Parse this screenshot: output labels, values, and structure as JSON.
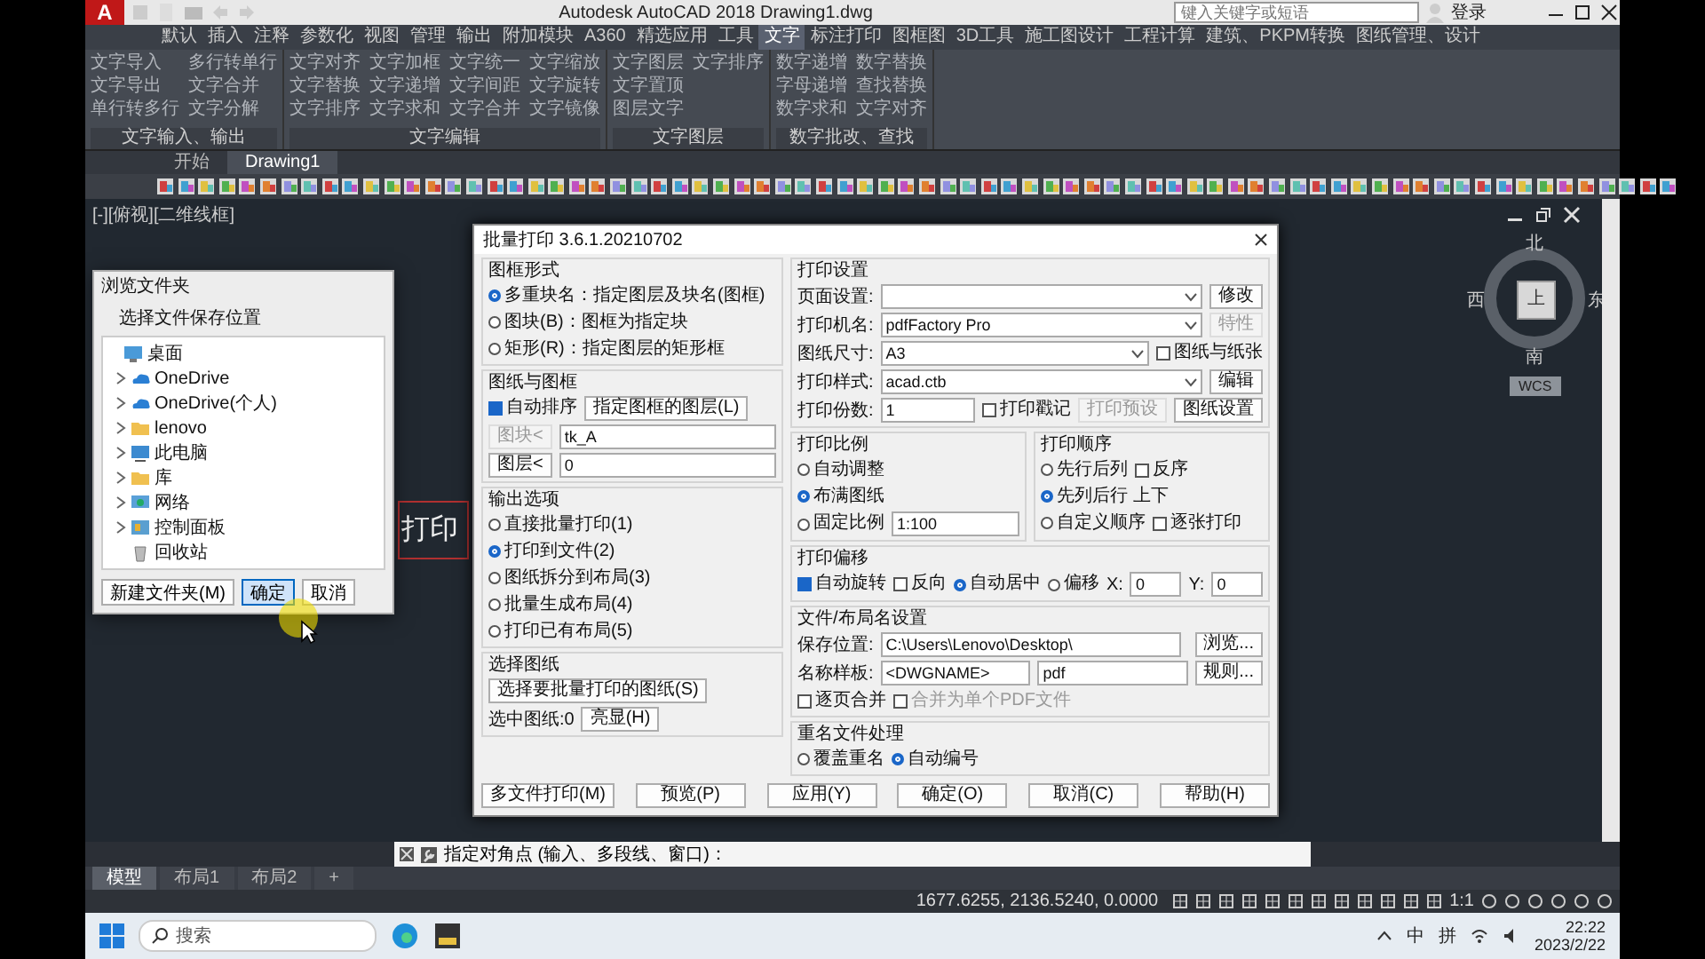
{
  "window": {
    "logo": "A",
    "title": "Autodesk AutoCAD 2018    Drawing1.dwg",
    "search_placeholder": "键入关键字或短语",
    "user": "登录"
  },
  "ribbon": {
    "tabs": [
      {
        "label": "默认",
        "selected": false
      },
      {
        "label": "插入",
        "selected": false
      },
      {
        "label": "注释",
        "selected": false
      },
      {
        "label": "参数化",
        "selected": false
      },
      {
        "label": "视图",
        "selected": false
      },
      {
        "label": "管理",
        "selected": false
      },
      {
        "label": "输出",
        "selected": false
      },
      {
        "label": "附加模块",
        "selected": false
      },
      {
        "label": "A360",
        "selected": false
      },
      {
        "label": "精选应用",
        "selected": false
      },
      {
        "label": "工具",
        "selected": false
      },
      {
        "label": "文字",
        "selected": true
      },
      {
        "label": "标注打印",
        "selected": false
      },
      {
        "label": "图框图",
        "selected": false
      },
      {
        "label": "3D工具",
        "selected": false
      },
      {
        "label": "施工图设计",
        "selected": false
      },
      {
        "label": "工程计算",
        "selected": false
      },
      {
        "label": "建筑、PKPM转换",
        "selected": false
      },
      {
        "label": "图纸管理、设计",
        "selected": false
      }
    ],
    "panels": [
      {
        "title": "文字输入、输出",
        "items": [
          "文字导入",
          "文字导出",
          "单行转多行",
          "多行转单行",
          "文字合并",
          "文字分解"
        ]
      },
      {
        "title": "文字编辑",
        "items": [
          "文字对齐",
          "文字替换",
          "文字排序",
          "文字加框",
          "文字递增",
          "文字求和",
          "文字统一",
          "文字间距",
          "文字合并",
          "文字缩放",
          "文字旋转",
          "文字镜像"
        ]
      },
      {
        "title": "文字图层",
        "items": [
          "文字图层",
          "文字置顶",
          "图层文字",
          "文字排序"
        ]
      },
      {
        "title": "数字批改、查找",
        "items": [
          "数字递增",
          "字母递增",
          "数字求和",
          "数字替换",
          "查找替换",
          "文字对齐"
        ]
      }
    ]
  },
  "file_tabs": [
    {
      "label": "开始",
      "selected": false
    },
    {
      "label": "Drawing1",
      "selected": true
    }
  ],
  "viewport_label": "[-][俯视][二维线框]",
  "drawing_text": "打印",
  "viewcube": {
    "north": "北",
    "west": "西",
    "east": "东",
    "south": "南",
    "face": "上",
    "ucs": "WCS"
  },
  "dialog": {
    "title": "批量打印 3.6.1.20210702",
    "left": [
      {
        "kind": "group",
        "title": "图框形式",
        "rows": [
          [
            {
              "kind": "radio",
              "label": "多重块名：指定图层及块名(图框)",
              "selected": true
            }
          ],
          [
            {
              "kind": "radio",
              "label": "图块(B)：图框为指定块",
              "selected": false
            }
          ],
          [
            {
              "kind": "radio",
              "label": "矩形(R)：指定图层的矩形框",
              "selected": false
            }
          ]
        ]
      },
      {
        "kind": "group",
        "title": "图纸与图框",
        "rows": [
          [
            {
              "kind": "checkbox",
              "label": "自动排序",
              "checked": true,
              "disabled": false
            },
            {
              "kind": "button",
              "label": "指定图框的图层(L)",
              "disabled": false
            }
          ],
          [
            {
              "kind": "button",
              "label": "图块<",
              "disabled": true
            },
            {
              "kind": "field",
              "value": "tk_A"
            }
          ],
          [
            {
              "kind": "button",
              "label": "图层<",
              "disabled": false
            },
            {
              "kind": "field",
              "value": "0"
            }
          ]
        ]
      },
      {
        "kind": "group",
        "title": "输出选项",
        "rows": [
          [
            {
              "kind": "radio",
              "label": "直接批量打印(1)",
              "selected": false
            }
          ],
          [
            {
              "kind": "radio",
              "label": "打印到文件(2)",
              "selected": true
            }
          ],
          [
            {
              "kind": "radio",
              "label": "图纸拆分到布局(3)",
              "selected": false
            }
          ],
          [
            {
              "kind": "radio",
              "label": "批量生成布局(4)",
              "selected": false
            }
          ],
          [
            {
              "kind": "radio",
              "label": "打印已有布局(5)",
              "selected": false
            }
          ]
        ]
      },
      {
        "kind": "group",
        "title": "选择图纸",
        "rows": [
          [
            {
              "kind": "button",
              "label": "选择要批量打印的图纸(S)",
              "disabled": false
            }
          ],
          [
            {
              "kind": "label",
              "text": "选中图纸:0"
            },
            {
              "kind": "button",
              "label": "亮显(H)",
              "disabled": false
            }
          ]
        ]
      }
    ],
    "right": [
      {
        "kind": "group",
        "title": "打印设置",
        "rows": [
          [
            {
              "kind": "label",
              "text": "页面设置:"
            },
            {
              "kind": "select"
            },
            {
              "kind": "button",
              "label": "修改",
              "disabled": false
            }
          ],
          [
            {
              "kind": "label",
              "text": "打印机名:"
            },
            {
              "kind": "select",
              "value": "pdfFactory Pro"
            },
            {
              "kind": "button",
              "label": "特性",
              "disabled": true
            }
          ],
          [
            {
              "kind": "label",
              "text": "图纸尺寸:"
            },
            {
              "kind": "select",
              "value": "A3"
            },
            {
              "kind": "checkbox",
              "label": "图纸与纸张",
              "checked": false,
              "disabled": false
            }
          ],
          [
            {
              "kind": "label",
              "text": "打印样式:"
            },
            {
              "kind": "select",
              "value": "acad.ctb"
            },
            {
              "kind": "button",
              "label": "编辑",
              "disabled": false
            }
          ],
          [
            {
              "kind": "label",
              "text": "打印份数:"
            },
            {
              "kind": "field",
              "value": "1"
            },
            {
              "kind": "checkbox",
              "label": "打印戳记",
              "checked": false,
              "disabled": false
            },
            {
              "kind": "button",
              "label": "打印预设",
              "disabled": true
            },
            {
              "kind": "button",
              "label": "图纸设置",
              "disabled": false
            }
          ]
        ]
      },
      {
        "kind": "pair",
        "groups": [
          {
            "kind": "group",
            "title": "打印比例",
            "rows": [
              [
                {
                  "kind": "radio",
                  "label": "自动调整",
                  "selected": false
                }
              ],
              [
                {
                  "kind": "radio",
                  "label": "布满图纸",
                  "selected": true
                }
              ],
              [
                {
                  "kind": "radio",
                  "label": "固定比例",
                  "selected": false
                },
                {
                  "kind": "field",
                  "value": "1:100"
                }
              ]
            ]
          },
          {
            "kind": "group",
            "title": "打印顺序",
            "rows": [
              [
                {
                  "kind": "radio",
                  "label": "先行后列",
                  "selected": false
                },
                {
                  "kind": "checkbox",
                  "label": "反序",
                  "checked": false,
                  "disabled": false
                }
              ],
              [
                {
                  "kind": "radio",
                  "label": "先列后行 上下",
                  "selected": true
                }
              ],
              [
                {
                  "kind": "radio",
                  "label": "自定义顺序",
                  "selected": false
                },
                {
                  "kind": "checkbox",
                  "label": "逐张打印",
                  "checked": false,
                  "disabled": false
                }
              ]
            ]
          }
        ]
      },
      {
        "kind": "group",
        "title": "打印偏移",
        "rows": [
          [
            {
              "kind": "checkbox",
              "label": "自动旋转",
              "checked": true,
              "disabled": false
            },
            {
              "kind": "checkbox",
              "label": "反向",
              "checked": false,
              "disabled": false
            },
            {
              "kind": "radio",
              "label": "自动居中",
              "selected": true
            },
            {
              "kind": "radio",
              "label": "偏移",
              "selected": false
            },
            {
              "kind": "label",
              "text": "X:"
            },
            {
              "kind": "field",
              "value": "0"
            },
            {
              "kind": "label",
              "text": "Y:"
            },
            {
              "kind": "field",
              "value": "0"
            }
          ]
        ]
      },
      {
        "kind": "group",
        "title": "文件/布局名设置",
        "rows": [
          [
            {
              "kind": "label",
              "text": "保存位置:"
            },
            {
              "kind": "field",
              "value": "C:\\Users\\Lenovo\\Desktop\\"
            },
            {
              "kind": "skip"
            },
            {
              "kind": "button",
              "label": "浏览...",
              "disabled": false
            }
          ],
          [
            {
              "kind": "label",
              "text": "名称样板:"
            },
            {
              "kind": "field",
              "value": "<DWGNAME>"
            },
            {
              "kind": "field",
              "value": "pdf"
            },
            {
              "kind": "button",
              "label": "规则...",
              "disabled": false
            }
          ],
          [
            {
              "kind": "checkbox",
              "label": "逐页合并",
              "checked": false,
              "disabled": false
            },
            {
              "kind": "checkbox",
              "label": "合并为单个PDF文件",
              "checked": false,
              "disabled": true
            }
          ]
        ]
      },
      {
        "kind": "group",
        "title": "重名文件处理",
        "rows": [
          [
            {
              "kind": "radio",
              "label": "覆盖重名",
              "selected": false
            },
            {
              "kind": "radio",
              "label": "自动编号",
              "selected": true
            }
          ]
        ]
      }
    ],
    "buttons": [
      {
        "label": "多文件打印(M)",
        "disabled": false
      },
      {
        "label": "预览(P)",
        "disabled": false
      },
      {
        "label": "应用(Y)",
        "disabled": false
      },
      {
        "label": "确定(O)",
        "disabled": false
      },
      {
        "label": "取消(C)",
        "disabled": false
      },
      {
        "label": "帮助(H)",
        "disabled": false
      }
    ]
  },
  "folder_dialog": {
    "title": "浏览文件夹",
    "prompt": "选择文件保存位置",
    "tree": [
      {
        "label": "桌面",
        "kind": "desktop",
        "expandable": false,
        "children": [
          {
            "label": "OneDrive",
            "kind": "cloud",
            "expandable": true
          },
          {
            "label": "OneDrive(个人)",
            "kind": "cloud",
            "expandable": true
          },
          {
            "label": "lenovo",
            "kind": "folder",
            "expandable": true
          },
          {
            "label": "此电脑",
            "kind": "pc",
            "expandable": true
          },
          {
            "label": "库",
            "kind": "folder",
            "expandable": true
          },
          {
            "label": "网络",
            "kind": "network",
            "expandable": true
          },
          {
            "label": "控制面板",
            "kind": "control",
            "expandable": true
          },
          {
            "label": "回收站",
            "kind": "trash",
            "expandable": false
          }
        ]
      }
    ],
    "buttons": [
      {
        "label": "新建文件夹(M)",
        "focused": false
      },
      {
        "label": "确定",
        "focused": true
      },
      {
        "label": "取消",
        "focused": false
      }
    ]
  },
  "command_line": {
    "text": "指定对角点 (输入、多段线、窗口)："
  },
  "layout_tabs": [
    {
      "label": "模型",
      "selected": true
    },
    {
      "label": "布局1",
      "selected": false
    },
    {
      "label": "布局2",
      "selected": false
    },
    {
      "label": "+",
      "selected": false
    }
  ],
  "status_bar": {
    "coords": "1677.6255, 2136.5240, 0.0000",
    "scale": "1:1"
  },
  "taskbar": {
    "search_placeholder": "搜索",
    "tray": [
      "中",
      "拼"
    ],
    "time": "22:22",
    "date": "2023/2/22"
  }
}
